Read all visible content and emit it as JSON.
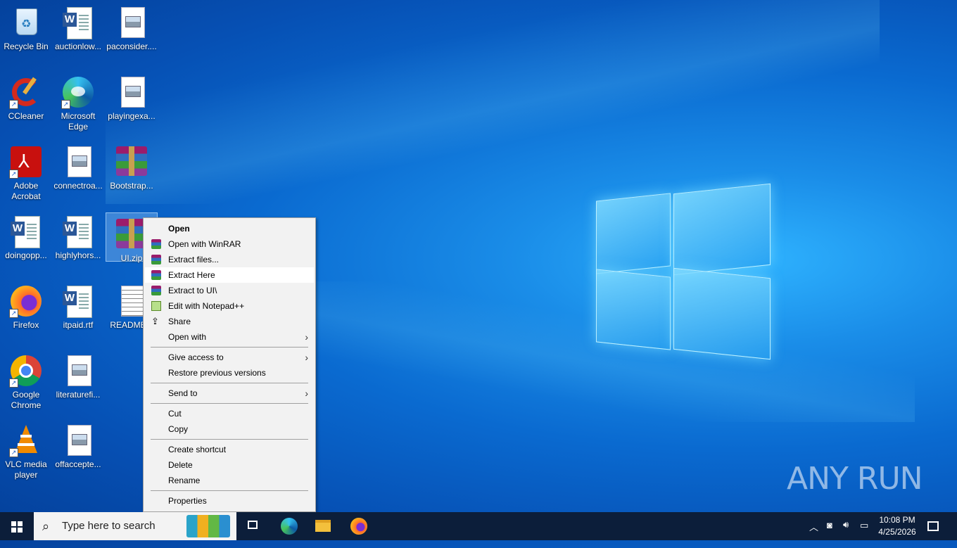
{
  "desktop_icons": [
    {
      "label": "Recycle Bin"
    },
    {
      "label": "auctionlow..."
    },
    {
      "label": "paconsider...."
    },
    {
      "label": "CCleaner"
    },
    {
      "label": "Microsoft Edge"
    },
    {
      "label": "playingexa..."
    },
    {
      "label": "Adobe Acrobat"
    },
    {
      "label": "connectroa..."
    },
    {
      "label": "Bootstrap..."
    },
    {
      "label": "doingopp..."
    },
    {
      "label": "highlyhors..."
    },
    {
      "label": "UI.zip"
    },
    {
      "label": "Firefox"
    },
    {
      "label": "itpaid.rtf"
    },
    {
      "label": "README..."
    },
    {
      "label": "Google Chrome"
    },
    {
      "label": "literaturefi..."
    },
    {
      "label": "VLC media player"
    },
    {
      "label": "offaccepte..."
    }
  ],
  "context_menu": {
    "items": [
      {
        "label": "Open"
      },
      {
        "label": "Open with WinRAR"
      },
      {
        "label": "Extract files..."
      },
      {
        "label": "Extract Here"
      },
      {
        "label": "Extract to UI\\"
      },
      {
        "label": "Edit with Notepad++"
      },
      {
        "label": "Share"
      },
      {
        "label": "Open with"
      },
      {
        "label": "Give access to"
      },
      {
        "label": "Restore previous versions"
      },
      {
        "label": "Send to"
      },
      {
        "label": "Cut"
      },
      {
        "label": "Copy"
      },
      {
        "label": "Create shortcut"
      },
      {
        "label": "Delete"
      },
      {
        "label": "Rename"
      },
      {
        "label": "Properties"
      }
    ],
    "highlighted": "Extract Here"
  },
  "taskbar": {
    "search_placeholder": "Type here to search",
    "clock_time": "10:08 PM",
    "clock_date": "4/25/2026"
  },
  "watermark": "ANY RUN",
  "colors": {
    "taskbar": "#0c1e3a",
    "menu_bg": "#f2f2f2",
    "wallpaper_blue": "#0a6ad0"
  }
}
